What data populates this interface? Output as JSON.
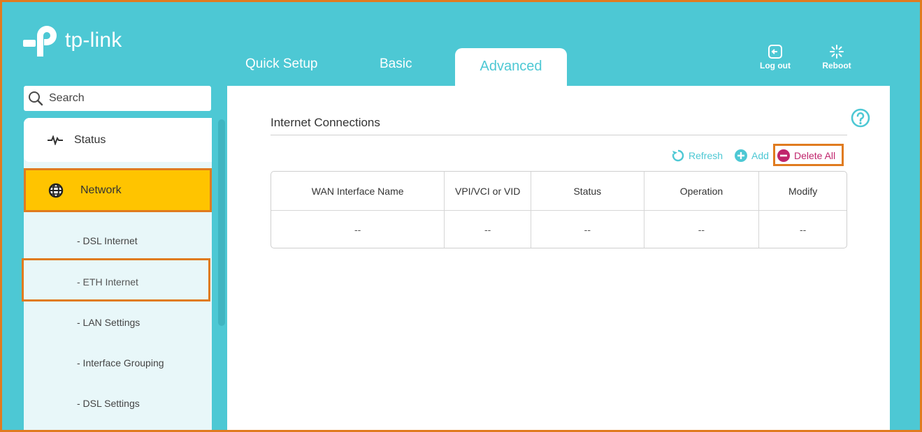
{
  "brand": {
    "name": "tp-link"
  },
  "tabs": [
    {
      "label": "Quick Setup",
      "active": false
    },
    {
      "label": "Basic",
      "active": false
    },
    {
      "label": "Advanced",
      "active": true
    }
  ],
  "top_actions": {
    "logout_label": "Log out",
    "reboot_label": "Reboot"
  },
  "search": {
    "placeholder": "Search"
  },
  "sidebar": {
    "items": [
      {
        "label": "Status",
        "icon": "pulse-icon"
      },
      {
        "label": "Network",
        "icon": "globe-icon",
        "active": true
      }
    ],
    "sub_items": [
      {
        "label": "- DSL Internet"
      },
      {
        "label": "- ETH Internet"
      },
      {
        "label": "- LAN Settings"
      },
      {
        "label": "- Interface Grouping"
      },
      {
        "label": "- DSL Settings"
      }
    ]
  },
  "content": {
    "section_title": "Internet Connections",
    "toolbar": {
      "refresh_label": "Refresh",
      "add_label": "Add",
      "delete_all_label": "Delete All"
    },
    "table": {
      "columns": [
        "WAN Interface Name",
        "VPI/VCI or VID",
        "Status",
        "Operation",
        "Modify"
      ],
      "rows": [
        [
          "--",
          "--",
          "--",
          "--",
          "--"
        ]
      ]
    }
  },
  "colors": {
    "header_bg": "#4dc8d4",
    "accent": "#4dc8d4",
    "active_item": "#ffc400",
    "highlight_border": "#e07b1f",
    "delete_color": "#c0256c"
  }
}
